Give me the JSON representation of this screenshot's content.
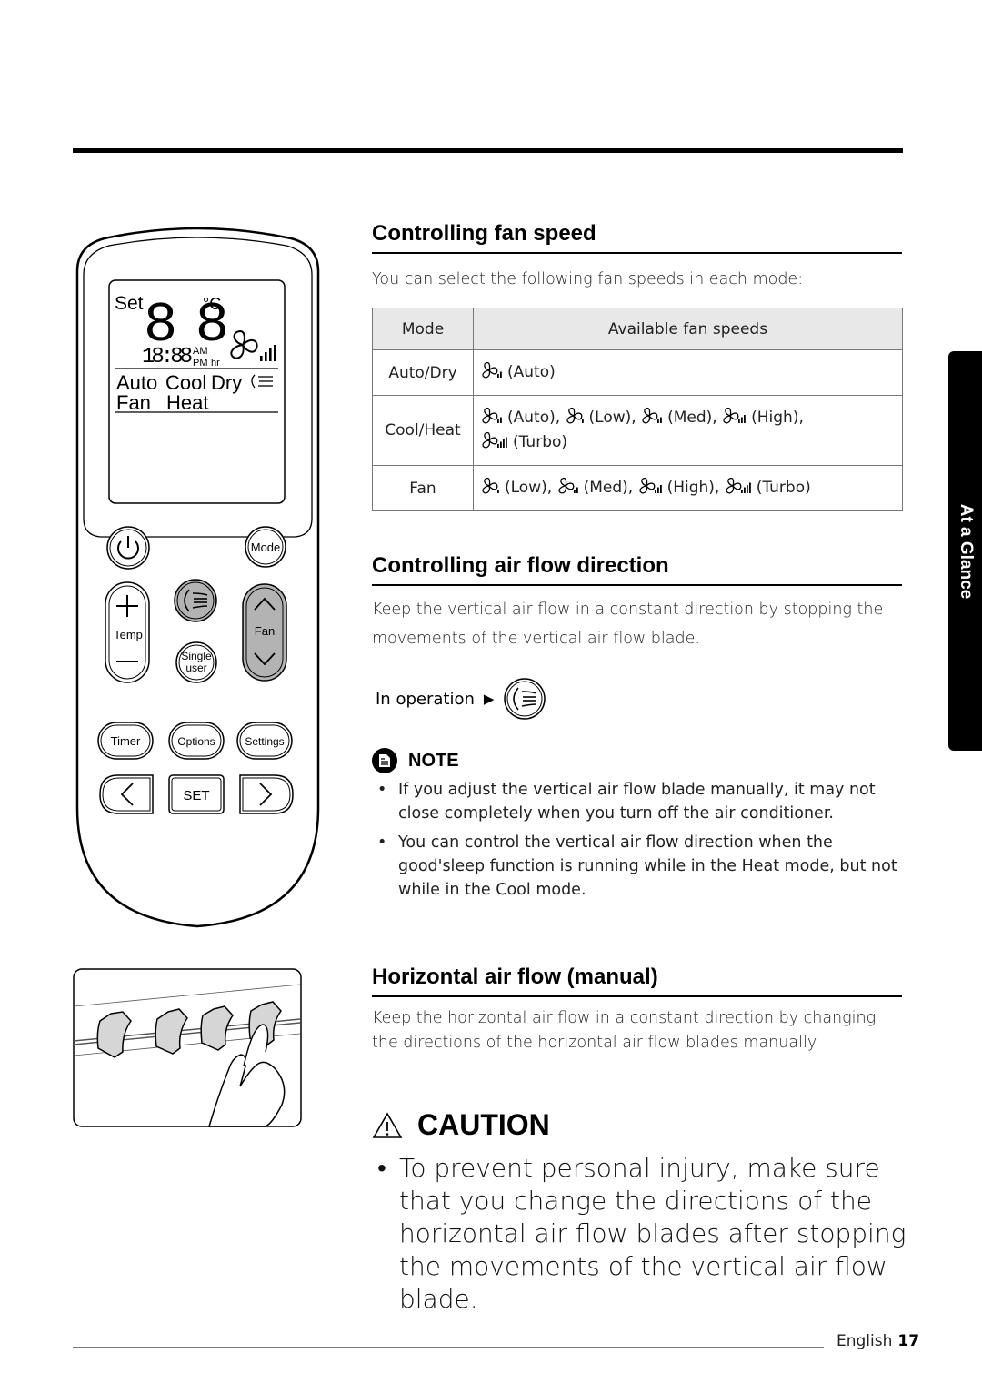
{
  "side_tab": {
    "label": "At a Glance"
  },
  "remote": {
    "lcd": {
      "set_label": "Set",
      "temp_digits": "88",
      "unit": "°C",
      "time_digits": "18:88",
      "am": "AM",
      "pm": "PM",
      "hr": "hr",
      "modes_row1": [
        "Auto",
        "Cool",
        "Dry"
      ],
      "modes_row2": [
        "Fan",
        "Heat"
      ]
    },
    "buttons": {
      "power": "power",
      "mode": "Mode",
      "temp": "Temp",
      "single_user_line1": "Single",
      "single_user_line2": "user",
      "fan": "Fan",
      "timer": "Timer",
      "options": "Options",
      "settings": "Settings",
      "set": "SET"
    }
  },
  "section_fan_speed": {
    "title": "Controlling fan speed",
    "intro": "You can select the following fan speeds in each mode:",
    "table": {
      "headers": [
        "Mode",
        "Available fan speeds"
      ],
      "rows": [
        {
          "mode": "Auto/Dry",
          "speeds": [
            {
              "icon": "fan-auto-icon",
              "label": "(Auto)"
            }
          ]
        },
        {
          "mode": "Cool/Heat",
          "speeds": [
            {
              "icon": "fan-auto-icon",
              "label": "(Auto),"
            },
            {
              "icon": "fan-low-icon",
              "label": "(Low),"
            },
            {
              "icon": "fan-med-icon",
              "label": "(Med),"
            },
            {
              "icon": "fan-high-icon",
              "label": "(High),"
            },
            {
              "icon": "fan-turbo-icon",
              "label": "(Turbo)"
            }
          ]
        },
        {
          "mode": "Fan",
          "speeds": [
            {
              "icon": "fan-low-icon",
              "label": "(Low),"
            },
            {
              "icon": "fan-med-icon",
              "label": "(Med),"
            },
            {
              "icon": "fan-high-icon",
              "label": "(High),"
            },
            {
              "icon": "fan-turbo-icon",
              "label": "(Turbo)"
            }
          ]
        }
      ]
    }
  },
  "section_air_flow_direction": {
    "title": "Controlling air flow direction",
    "body": "Keep the vertical air flow in a constant direction by stopping the movements of the vertical air flow blade.",
    "in_operation_label": "In operation",
    "arrow": "▶",
    "note": {
      "label": "NOTE",
      "items": [
        "If you adjust the vertical air flow blade manually, it may not close completely when you turn off the air conditioner.",
        "You can control the vertical air flow direction when the good'sleep function is running while in the Heat mode, but not while in the Cool mode."
      ]
    }
  },
  "section_horizontal": {
    "title": "Horizontal air flow (manual)",
    "body": "Keep the horizontal air flow in a constant direction by changing the directions of the horizontal air flow blades manually."
  },
  "caution": {
    "label": "CAUTION",
    "text": "To prevent personal injury, make sure that you change the directions of the horizontal air flow blades after stopping the movements of the vertical air flow blade."
  },
  "footer": {
    "language": "English",
    "page_number": "17"
  },
  "colors": {
    "table_header_bg": "#e8e8e8",
    "fan_button_fill": "#b3b3b3",
    "side_tab_bg": "#000000"
  }
}
